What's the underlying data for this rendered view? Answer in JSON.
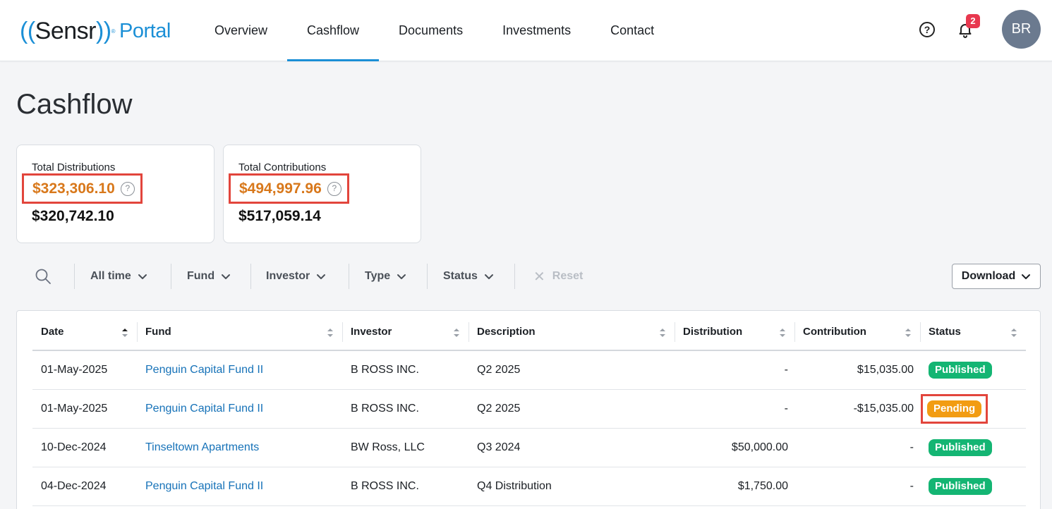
{
  "header": {
    "logo": {
      "prefix": "((",
      "brand": "Sensr",
      "suffix": "))",
      "mark": "®",
      "portal": "Portal"
    },
    "tabs": [
      {
        "label": "Overview",
        "active": false
      },
      {
        "label": "Cashflow",
        "active": true
      },
      {
        "label": "Documents",
        "active": false
      },
      {
        "label": "Investments",
        "active": false
      },
      {
        "label": "Contact",
        "active": false
      }
    ],
    "help": "?",
    "notification_count": "2",
    "avatar_initials": "BR"
  },
  "page": {
    "title": "Cashflow"
  },
  "summary": {
    "distributions": {
      "label": "Total Distributions",
      "highlight_amount": "$323,306.10",
      "amount": "$320,742.10",
      "help": "?"
    },
    "contributions": {
      "label": "Total Contributions",
      "highlight_amount": "$494,997.96",
      "amount": "$517,059.14",
      "help": "?"
    }
  },
  "filters": {
    "items": [
      "All time",
      "Fund",
      "Investor",
      "Type",
      "Status"
    ],
    "reset": "Reset",
    "download": "Download"
  },
  "table": {
    "columns": [
      "Date",
      "Fund",
      "Investor",
      "Description",
      "Distribution",
      "Contribution",
      "Status"
    ],
    "rows": [
      {
        "date": "01-May-2025",
        "fund": "Penguin Capital Fund II",
        "investor": "B ROSS INC.",
        "description": "Q2 2025",
        "distribution": "-",
        "contribution": "$15,035.00",
        "status": "Published"
      },
      {
        "date": "01-May-2025",
        "fund": "Penguin Capital Fund II",
        "investor": "B ROSS INC.",
        "description": "Q2 2025",
        "distribution": "-",
        "contribution": "-$15,035.00",
        "status": "Pending"
      },
      {
        "date": "10-Dec-2024",
        "fund": "Tinseltown Apartments",
        "investor": "BW Ross, LLC",
        "description": "Q3 2024",
        "distribution": "$50,000.00",
        "contribution": "-",
        "status": "Published"
      },
      {
        "date": "04-Dec-2024",
        "fund": "Penguin Capital Fund II",
        "investor": "B ROSS INC.",
        "description": "Q4 Distribution",
        "distribution": "$1,750.00",
        "contribution": "-",
        "status": "Published"
      }
    ]
  },
  "colors": {
    "accent": "#1b8fd6",
    "highlight": "#d8781b",
    "published": "#14b573",
    "pending": "#f29c12",
    "annotation": "#e2453c"
  }
}
